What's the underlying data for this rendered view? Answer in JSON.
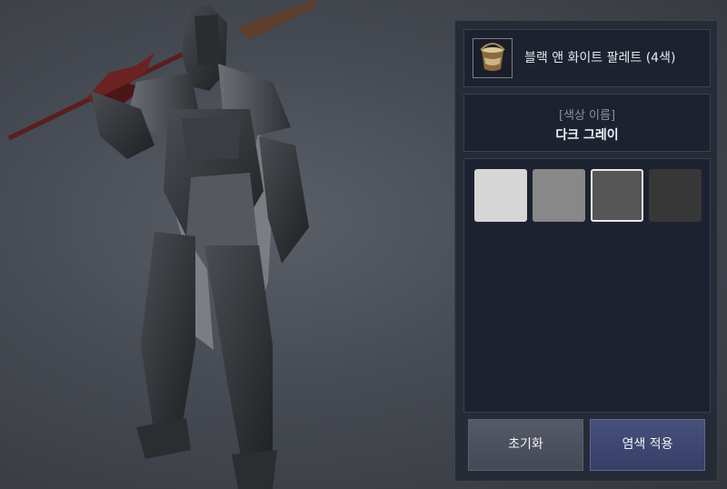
{
  "item": {
    "name": "블랙 앤 화이트 팔레트 (4색)",
    "icon": "dye-bucket-icon"
  },
  "color_name": {
    "label": "[색상 이름]",
    "value": "다크 그레이"
  },
  "swatches": [
    {
      "color": "#d6d6d6",
      "selected": false
    },
    {
      "color": "#888888",
      "selected": false
    },
    {
      "color": "#565656",
      "selected": true
    },
    {
      "color": "#373737",
      "selected": false
    }
  ],
  "buttons": {
    "reset_label": "초기화",
    "apply_label": "염색 적용"
  }
}
